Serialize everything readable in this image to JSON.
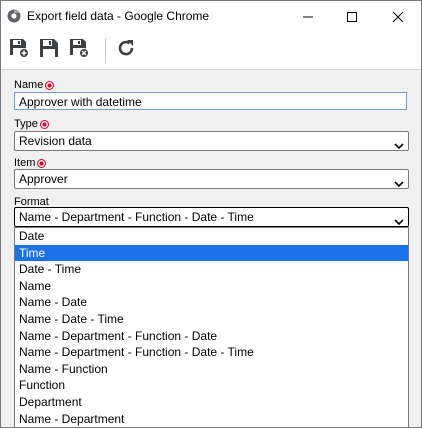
{
  "window": {
    "title": "Export field data - Google Chrome"
  },
  "toolbar": {
    "buttons": [
      {
        "name": "save-new-icon"
      },
      {
        "name": "save-icon"
      },
      {
        "name": "save-close-icon"
      },
      {
        "name": "refresh-icon"
      }
    ]
  },
  "form": {
    "name_label": "Name",
    "name_value": "Approver with datetime",
    "type_label": "Type",
    "type_value": "Revision data",
    "item_label": "Item",
    "item_value": "Approver",
    "format_label": "Format",
    "format_value": "Name - Department - Function - Date - Time"
  },
  "format_options": [
    "Date",
    "Time",
    "Date - Time",
    "Name",
    "Name - Date",
    "Name - Date - Time",
    "Name - Department - Function - Date",
    "Name - Department - Function - Date - Time",
    "Name - Function",
    "Function",
    "Department",
    "Name - Department"
  ],
  "highlighted_option": "Time",
  "colors": {
    "required": "#e0002a",
    "highlight": "#1a73e8"
  }
}
